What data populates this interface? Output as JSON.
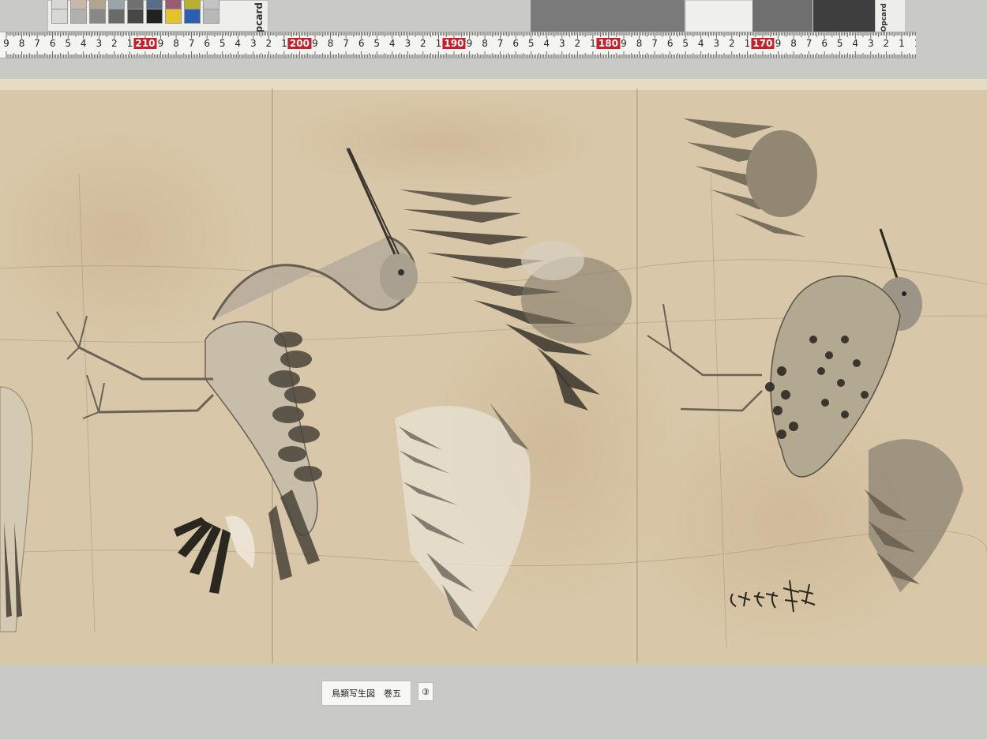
{
  "color_card": {
    "label": "Opcard",
    "swatches_top": [
      "#d8d6d2",
      "#c9b8a8",
      "#b0a690",
      "#9ba4a8",
      "#707070",
      "#5b6c8a",
      "#9a5a70",
      "#b8b030",
      "#c4c4c4"
    ],
    "swatches_bottom": [
      "#d7d7d5",
      "#b0b0ae",
      "#888886",
      "#6a6a68",
      "#474745",
      "#222220",
      "#e3c22a",
      "#2d5fb0",
      "#b8b8b6"
    ]
  },
  "grey_card": {
    "label": "Opcard"
  },
  "ruler": {
    "marks": [
      "9",
      "8",
      "7",
      "6",
      "5",
      "4",
      "3",
      "2",
      "1",
      "210",
      "9",
      "8",
      "7",
      "6",
      "5",
      "4",
      "3",
      "2",
      "1",
      "200",
      "9",
      "8",
      "7",
      "6",
      "5",
      "4",
      "3",
      "2",
      "1",
      "190",
      "9",
      "8",
      "7",
      "6",
      "5",
      "4",
      "3",
      "2",
      "1",
      "180",
      "9",
      "8",
      "7",
      "6",
      "5",
      "4",
      "3",
      "2",
      "1",
      "170",
      "9",
      "8",
      "7",
      "6",
      "5",
      "4",
      "3",
      "2",
      "1",
      "1"
    ],
    "major_marks": [
      "210",
      "200",
      "190",
      "180",
      "170"
    ],
    "major_color": "#c8202a"
  },
  "painting": {
    "subject": "bird sketches: heron, spread wings, snipe",
    "paper_color": "#d8c7a8",
    "ink_color": "#3a342c"
  },
  "caption": {
    "title": "鳥類写生図　巻五",
    "panel_number": "③"
  }
}
